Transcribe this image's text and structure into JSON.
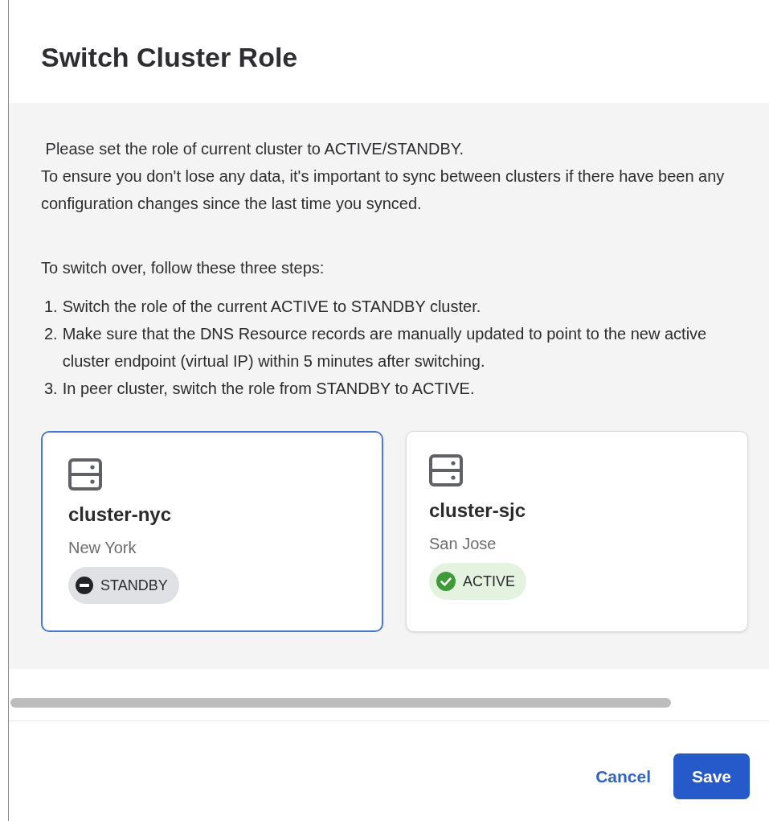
{
  "dialog": {
    "title": "Switch Cluster Role"
  },
  "intro": [
    " Please set the role of current cluster to ACTIVE/STANDBY.",
    "To ensure you don't lose any data, it's important to sync between clusters if there have been any configuration changes since the last time you synced."
  ],
  "steps_heading": "To switch over, follow these three steps:",
  "steps": [
    {
      "number": "1.",
      "text": "Switch the role of the current ACTIVE to STANDBY cluster."
    },
    {
      "number": "2.",
      "text": "Make sure that the DNS Resource records are manually updated to point to the new active cluster endpoint (virtual IP) within 5 minutes after switching."
    },
    {
      "number": "3.",
      "text": "In peer cluster, switch the role from STANDBY to ACTIVE."
    }
  ],
  "clusters": [
    {
      "name": "cluster-nyc",
      "location": "New York",
      "status": "STANDBY",
      "kind": "standby",
      "selected": true
    },
    {
      "name": "cluster-sjc",
      "location": "San Jose",
      "status": "ACTIVE",
      "kind": "active",
      "selected": false
    }
  ],
  "buttons": {
    "cancel": "Cancel",
    "save": "Save"
  }
}
